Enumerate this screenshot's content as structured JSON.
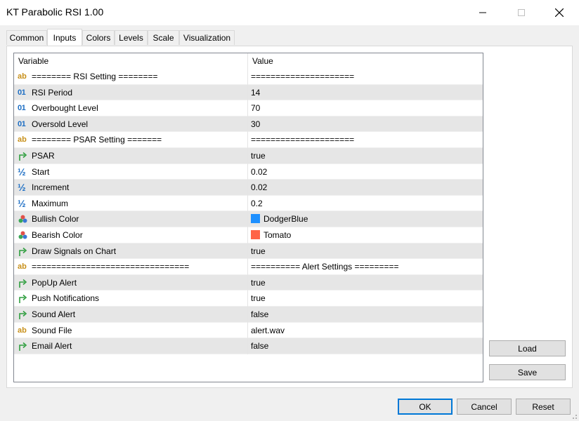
{
  "window": {
    "title": "KT Parabolic RSI 1.00"
  },
  "tabs": [
    {
      "label": "Common"
    },
    {
      "label": "Inputs"
    },
    {
      "label": "Colors"
    },
    {
      "label": "Levels"
    },
    {
      "label": "Scale"
    },
    {
      "label": "Visualization"
    }
  ],
  "active_tab": "Inputs",
  "grid": {
    "headers": {
      "variable": "Variable",
      "value": "Value"
    },
    "rows": [
      {
        "icon": "string-icon",
        "variable": "======== RSI Setting ========",
        "value": "====================="
      },
      {
        "icon": "integer-icon",
        "variable": "RSI Period",
        "value": "14"
      },
      {
        "icon": "integer-icon",
        "variable": "Overbought Level",
        "value": "70"
      },
      {
        "icon": "integer-icon",
        "variable": "Oversold Level",
        "value": "30"
      },
      {
        "icon": "string-icon",
        "variable": "======== PSAR Setting =======",
        "value": "====================="
      },
      {
        "icon": "boolean-icon",
        "variable": "PSAR",
        "value": "true"
      },
      {
        "icon": "double-icon",
        "variable": "Start",
        "value": "0.02"
      },
      {
        "icon": "double-icon",
        "variable": "Increment",
        "value": "0.02"
      },
      {
        "icon": "double-icon",
        "variable": "Maximum",
        "value": "0.2"
      },
      {
        "icon": "color-icon",
        "variable": "Bullish Color",
        "value": "DodgerBlue",
        "swatch": "#1e90ff"
      },
      {
        "icon": "color-icon",
        "variable": "Bearish Color",
        "value": "Tomato",
        "swatch": "#ff6347"
      },
      {
        "icon": "boolean-icon",
        "variable": "Draw Signals on Chart",
        "value": "true"
      },
      {
        "icon": "string-icon",
        "variable": "================================",
        "value": "==========  Alert Settings ========="
      },
      {
        "icon": "boolean-icon",
        "variable": "PopUp Alert",
        "value": "true"
      },
      {
        "icon": "boolean-icon",
        "variable": "Push Notifications",
        "value": "true"
      },
      {
        "icon": "boolean-icon",
        "variable": "Sound Alert",
        "value": "false"
      },
      {
        "icon": "string-icon",
        "variable": "Sound File",
        "value": "alert.wav"
      },
      {
        "icon": "boolean-icon",
        "variable": "Email Alert",
        "value": "false"
      }
    ]
  },
  "icon_glyphs": {
    "integer": "01",
    "string": "ab",
    "double": "½"
  },
  "buttons": {
    "load": "Load",
    "save": "Save",
    "ok": "OK",
    "cancel": "Cancel",
    "reset": "Reset"
  },
  "colors": {
    "accent": "#0078d7",
    "alt_row": "#e6e6e6",
    "bool_icon": "#2e9e3e"
  }
}
